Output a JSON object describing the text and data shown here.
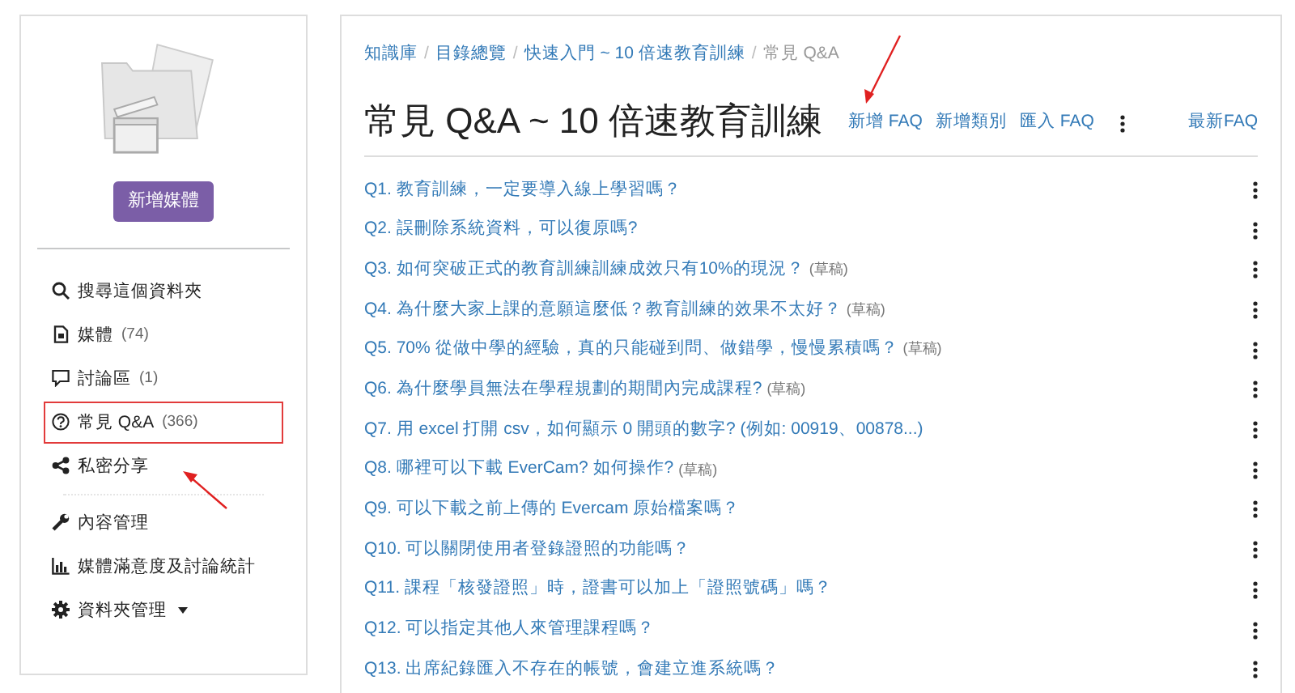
{
  "sidebar": {
    "add_button": "新增媒體",
    "items": [
      {
        "kind": "search",
        "label": "搜尋這個資料夾",
        "highlighted": false
      },
      {
        "kind": "media",
        "label": "媒體",
        "count": "(74)",
        "highlighted": false
      },
      {
        "kind": "discussion",
        "label": "討論區",
        "count": "(1)",
        "highlighted": false
      },
      {
        "kind": "faq",
        "label": "常見 Q&A",
        "count": "(366)",
        "highlighted": true
      },
      {
        "kind": "share",
        "label": "私密分享",
        "highlighted": false
      }
    ],
    "admin_items": [
      {
        "kind": "content",
        "label": "內容管理",
        "dropdown": false
      },
      {
        "kind": "stats",
        "label": "媒體滿意度及討論統計",
        "dropdown": false
      },
      {
        "kind": "settings",
        "label": "資料夾管理",
        "dropdown": true
      }
    ]
  },
  "breadcrumb": [
    "知識庫",
    "目錄總覽",
    "快速入門 ~ 10 倍速教育訓練",
    "常見 Q&A"
  ],
  "breadcrumb_separators": [
    "/",
    "/",
    "/"
  ],
  "title": "常見 Q&A ~ 10 倍速教育訓練",
  "actions": [
    "新增 FAQ",
    "新增類別",
    "匯入 FAQ"
  ],
  "latest_link": "最新FAQ",
  "questions": [
    {
      "number": "Q1.",
      "text": "教育訓練，一定要導入線上學習嗎？"
    },
    {
      "number": "Q2.",
      "text": "誤刪除系統資料，可以復原嗎?"
    },
    {
      "number": "Q3.",
      "text": "如何突破正式的教育訓練訓練成效只有10%的現況？",
      "note": "(草稿)"
    },
    {
      "number": "Q4.",
      "text": "為什麼大家上課的意願這麼低？教育訓練的效果不太好？",
      "note": "(草稿)"
    },
    {
      "number": "Q5.",
      "text": "70% 從做中學的經驗，真的只能碰到問、做錯學，慢慢累積嗎？",
      "note": "(草稿)"
    },
    {
      "number": "Q6.",
      "text": "為什麼學員無法在學程規劃的期間內完成課程?",
      "note": "(草稿)"
    },
    {
      "number": "Q7.",
      "text": "用 excel 打開 csv，如何顯示 0 開頭的數字? (例如: 00919、00878...)"
    },
    {
      "number": "Q8.",
      "text": "哪裡可以下載 EverCam? 如何操作?",
      "note": "(草稿)"
    },
    {
      "number": "Q9.",
      "text": "可以下載之前上傳的 Evercam 原始檔案嗎？"
    },
    {
      "number": "Q10.",
      "text": "可以關閉使用者登錄證照的功能嗎？"
    },
    {
      "number": "Q11.",
      "text": "課程「核發證照」時，證書可以加上「證照號碼」嗎？"
    },
    {
      "number": "Q12.",
      "text": "可以指定其他人來管理課程嗎？"
    },
    {
      "number": "Q13.",
      "text": "出席紀錄匯入不存在的帳號，會建立進系統嗎？"
    }
  ]
}
